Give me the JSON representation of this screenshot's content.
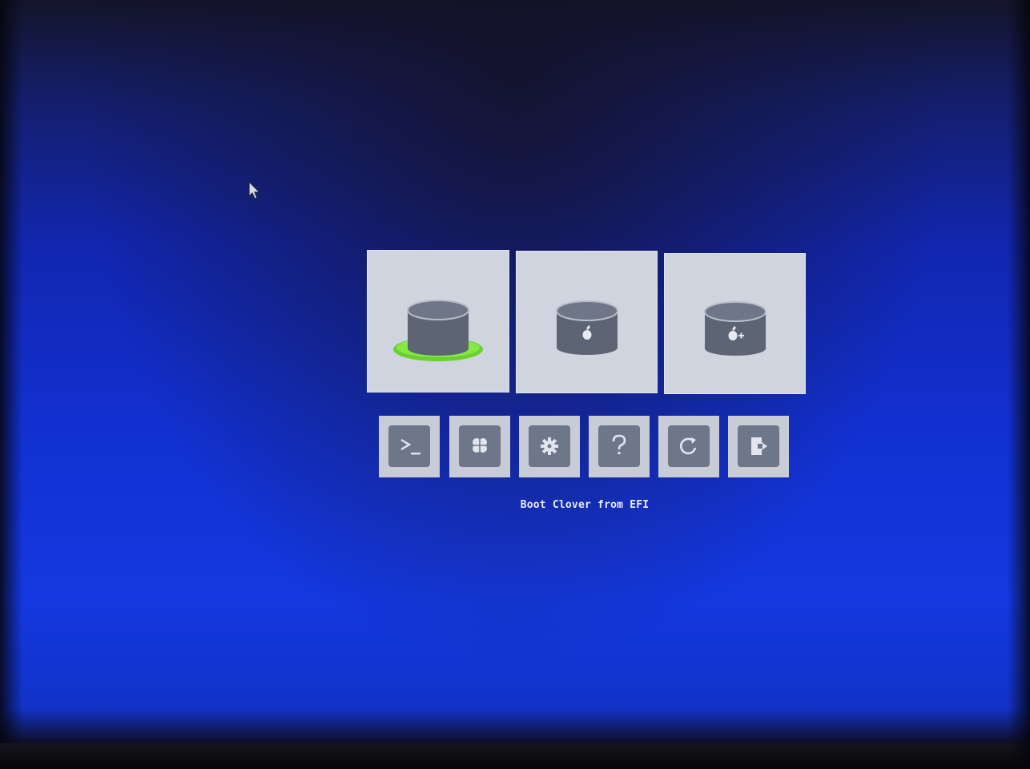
{
  "boot_menu": {
    "entries": [
      {
        "icon": "clover-efi-disk-icon",
        "selected": true
      },
      {
        "icon": "macos-disk-icon",
        "selected": false
      },
      {
        "icon": "macos-install-disk-icon",
        "selected": false
      }
    ],
    "tools": [
      {
        "icon": "shell-icon",
        "label": ">_"
      },
      {
        "icon": "clover-options-icon"
      },
      {
        "icon": "gear-icon"
      },
      {
        "icon": "help-icon",
        "label": "?"
      },
      {
        "icon": "reboot-icon"
      },
      {
        "icon": "exit-icon"
      }
    ],
    "selected_caption": "Boot Clover from EFI"
  },
  "colors": {
    "background": "#1232c8",
    "tile": "#cfd4de",
    "disk": "#5d6474",
    "tool_inner": "#6e7689",
    "selection_ring": "#7ee03a",
    "caption_text": "#e8ecf8"
  }
}
